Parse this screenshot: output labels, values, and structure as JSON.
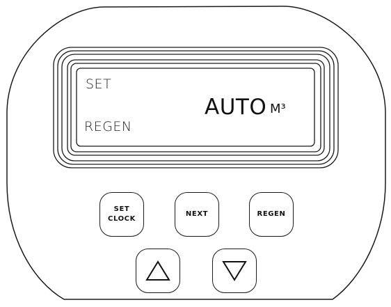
{
  "display": {
    "set_label": "SET",
    "regen_label": "REGEN",
    "mode": "AUTO",
    "unit": "M³"
  },
  "keys": {
    "set_clock": [
      "SET",
      "CLOCK"
    ],
    "next": "NEXT",
    "regen": "REGEN",
    "up_icon": "up-arrow-triangle",
    "down_icon": "down-arrow-triangle"
  }
}
